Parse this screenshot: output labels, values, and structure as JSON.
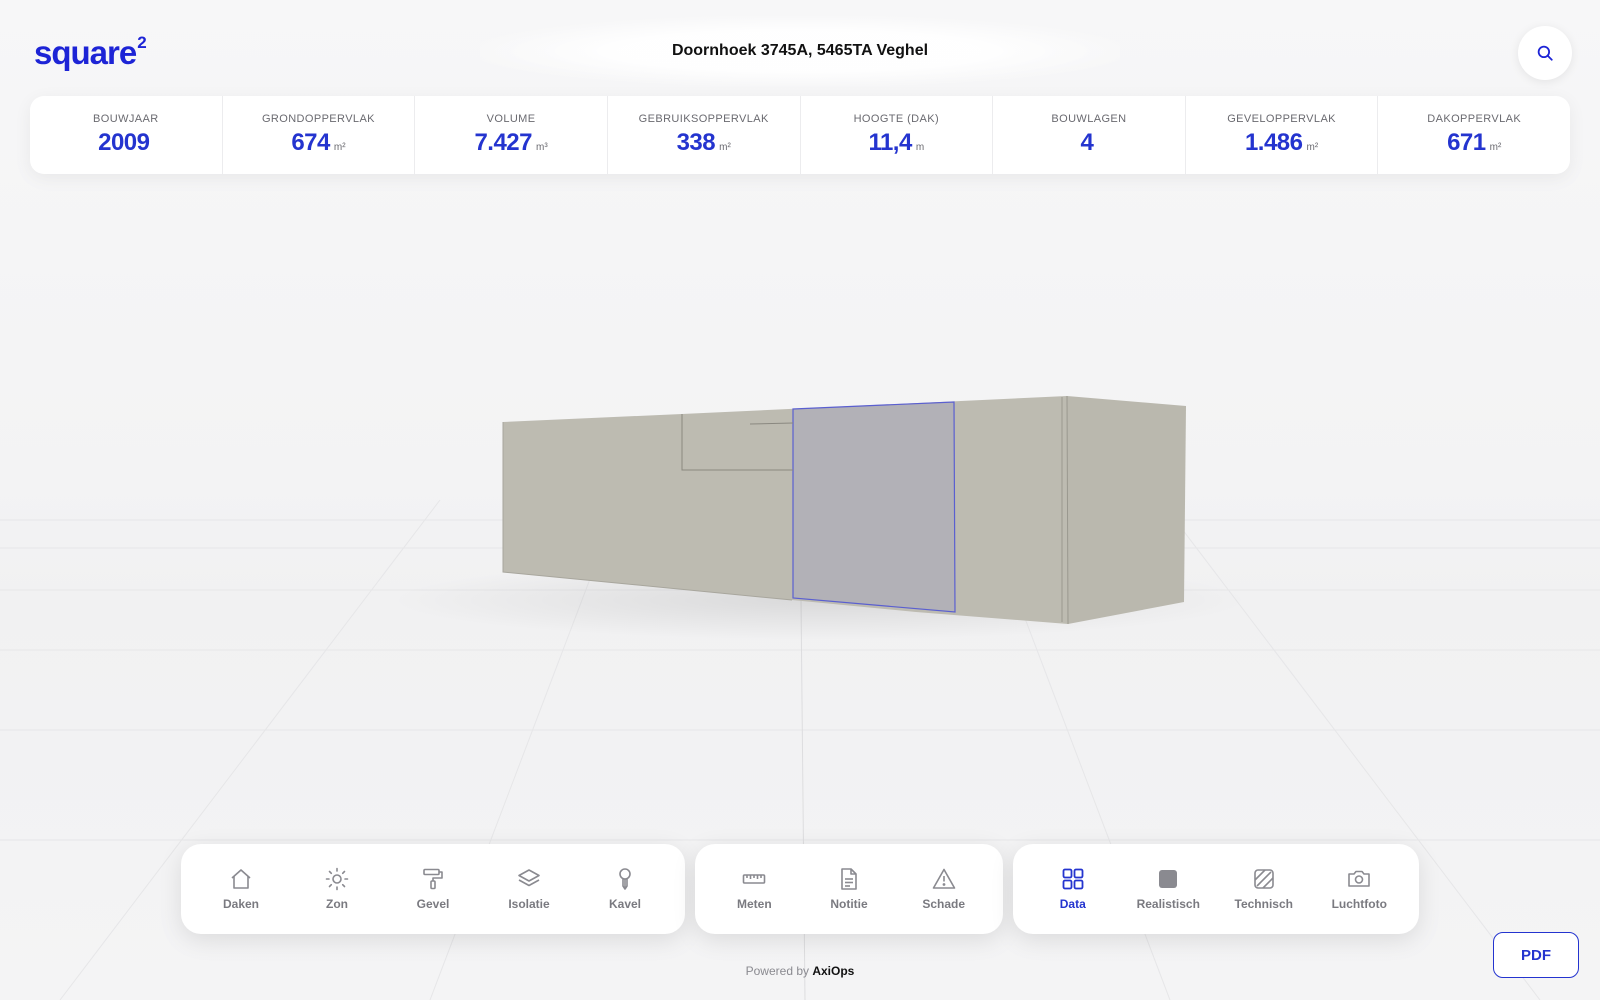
{
  "app": {
    "logo_text": "square",
    "logo_sup": "2",
    "address": "Doornhoek 3745A, 5465TA Veghel"
  },
  "stats": [
    {
      "label": "BOUWJAAR",
      "value": "2009",
      "unit": ""
    },
    {
      "label": "GRONDOPPERVLAK",
      "value": "674",
      "unit": "m²"
    },
    {
      "label": "VOLUME",
      "value": "7.427",
      "unit": "m³"
    },
    {
      "label": "GEBRUIKSOPPERVLAK",
      "value": "338",
      "unit": "m²"
    },
    {
      "label": "HOOGTE (DAK)",
      "value": "11,4",
      "unit": "m"
    },
    {
      "label": "BOUWLAGEN",
      "value": "4",
      "unit": ""
    },
    {
      "label": "GEVELOPPERVLAK",
      "value": "1.486",
      "unit": "m²"
    },
    {
      "label": "DAKOPPERVLAK",
      "value": "671",
      "unit": "m²"
    }
  ],
  "toolbar": {
    "group1": [
      {
        "label": "Daken",
        "icon": "house-icon"
      },
      {
        "label": "Zon",
        "icon": "sun-icon"
      },
      {
        "label": "Gevel",
        "icon": "paint-roller-icon"
      },
      {
        "label": "Isolatie",
        "icon": "layers-icon"
      },
      {
        "label": "Kavel",
        "icon": "map-pin-icon"
      }
    ],
    "group2": [
      {
        "label": "Meten",
        "icon": "ruler-icon"
      },
      {
        "label": "Notitie",
        "icon": "document-icon"
      },
      {
        "label": "Schade",
        "icon": "warning-icon"
      }
    ],
    "group3": [
      {
        "label": "Data",
        "icon": "grid-icon",
        "active": true
      },
      {
        "label": "Realistisch",
        "icon": "filled-square-icon"
      },
      {
        "label": "Technisch",
        "icon": "hatched-square-icon"
      },
      {
        "label": "Luchtfoto",
        "icon": "camera-icon"
      }
    ]
  },
  "footer": {
    "powered_prefix": "Powered by",
    "powered_brand": "AxiOps",
    "pdf_label": "PDF"
  },
  "colors": {
    "accent": "#2434cf",
    "brand": "#1d24d6",
    "building": "#bcbab0",
    "selected_face": "#b1b0b6"
  }
}
